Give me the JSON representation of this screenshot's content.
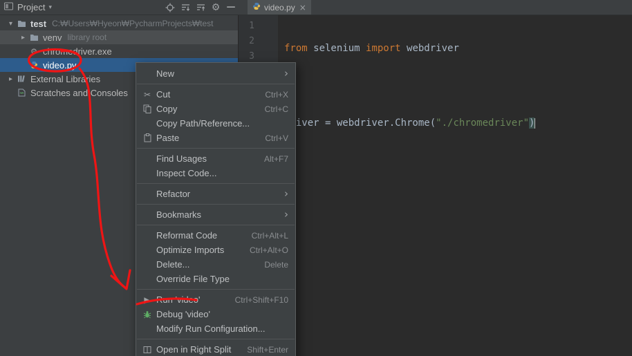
{
  "project": {
    "title": "Project",
    "items": [
      {
        "label": "test",
        "detail": "C:₩Users₩Hyeon₩PycharmProjects₩test"
      },
      {
        "label": "venv",
        "detail": "library root"
      },
      {
        "label": "chromedriver.exe"
      },
      {
        "label": "video.py"
      },
      {
        "label": "External Libraries"
      },
      {
        "label": "Scratches and Consoles"
      }
    ]
  },
  "editor": {
    "tab_label": "video.py",
    "gutter": [
      "1",
      "2",
      "3"
    ],
    "code": {
      "line1": {
        "kw1": "from",
        "mid": " selenium ",
        "kw2": "import",
        "tail": " webdriver"
      },
      "line3": {
        "head": "driver = webdriver.Chrome(",
        "str": "\"./chromedriver\"",
        "close": ")"
      }
    }
  },
  "context_menu": {
    "items": [
      {
        "label": "New",
        "submenu": true
      },
      {
        "label": "Cut",
        "shortcut": "Ctrl+X"
      },
      {
        "label": "Copy",
        "shortcut": "Ctrl+C"
      },
      {
        "label": "Copy Path/Reference..."
      },
      {
        "label": "Paste",
        "shortcut": "Ctrl+V"
      },
      {
        "label": "Find Usages",
        "shortcut": "Alt+F7"
      },
      {
        "label": "Inspect Code..."
      },
      {
        "label": "Refactor",
        "submenu": true
      },
      {
        "label": "Bookmarks",
        "submenu": true
      },
      {
        "label": "Reformat Code",
        "shortcut": "Ctrl+Alt+L"
      },
      {
        "label": "Optimize Imports",
        "shortcut": "Ctrl+Alt+O"
      },
      {
        "label": "Delete...",
        "shortcut": "Delete"
      },
      {
        "label": "Override File Type"
      },
      {
        "label": "Run 'video'",
        "shortcut": "Ctrl+Shift+F10"
      },
      {
        "label": "Debug 'video'"
      },
      {
        "label": "Modify Run Configuration..."
      },
      {
        "label": "Open in Right Split",
        "shortcut": "Shift+Enter"
      }
    ]
  },
  "glyphs": {
    "caret": "▾",
    "chevron_down": "▾",
    "chevron_right": "▸",
    "close": "×",
    "minus": "—",
    "gear": "⚙",
    "scissors": "✂",
    "run": "▶",
    "submenu": "›"
  },
  "colors": {
    "panel_bg": "#3c3f41",
    "editor_bg": "#2b2b2b",
    "selection_blue": "#2d5c8c",
    "keyword_orange": "#cc7832",
    "string_green": "#6a8759",
    "run_green": "#5fad65",
    "annotation_red": "#ee1515"
  }
}
